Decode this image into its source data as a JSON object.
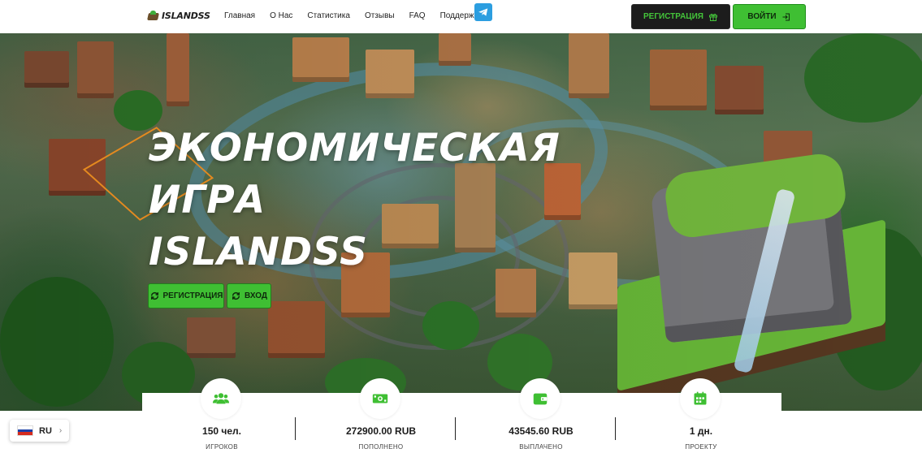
{
  "header": {
    "logo_text": "ISLANDSS",
    "nav": [
      "Главная",
      "О Нас",
      "Статистика",
      "Отзывы",
      "FAQ",
      "Поддержка"
    ],
    "register_label": "РЕГИСТРАЦИЯ",
    "login_label": "ВОЙТИ",
    "telegram_icon": "telegram-icon"
  },
  "hero": {
    "title_lines": [
      "ЭКОНОМИЧЕСКАЯ",
      "ИГРА",
      "ISLANDSS"
    ],
    "register_label": "РЕГИСТРАЦИЯ",
    "login_label": "ВХОД"
  },
  "stats": [
    {
      "icon": "users-icon",
      "value": "150 чел.",
      "label": "ИГРОКОВ"
    },
    {
      "icon": "money-icon",
      "value": "272900.00 RUB",
      "label": "ПОПОЛНЕНО"
    },
    {
      "icon": "wallet-icon",
      "value": "43545.60 RUB",
      "label": "ВЫПЛАЧЕНО"
    },
    {
      "icon": "calendar-icon",
      "value": "1 дн.",
      "label": "ПРОЕКТУ"
    }
  ],
  "language": {
    "code": "RU",
    "flag_colors": [
      "#ffffff",
      "#1c3fa8",
      "#d52b1e"
    ]
  },
  "colors": {
    "accent_green": "#3fbf33",
    "dark_button": "#1c1c1c",
    "telegram_blue": "#2c9ee0",
    "title_outline": "#e58a1f"
  }
}
